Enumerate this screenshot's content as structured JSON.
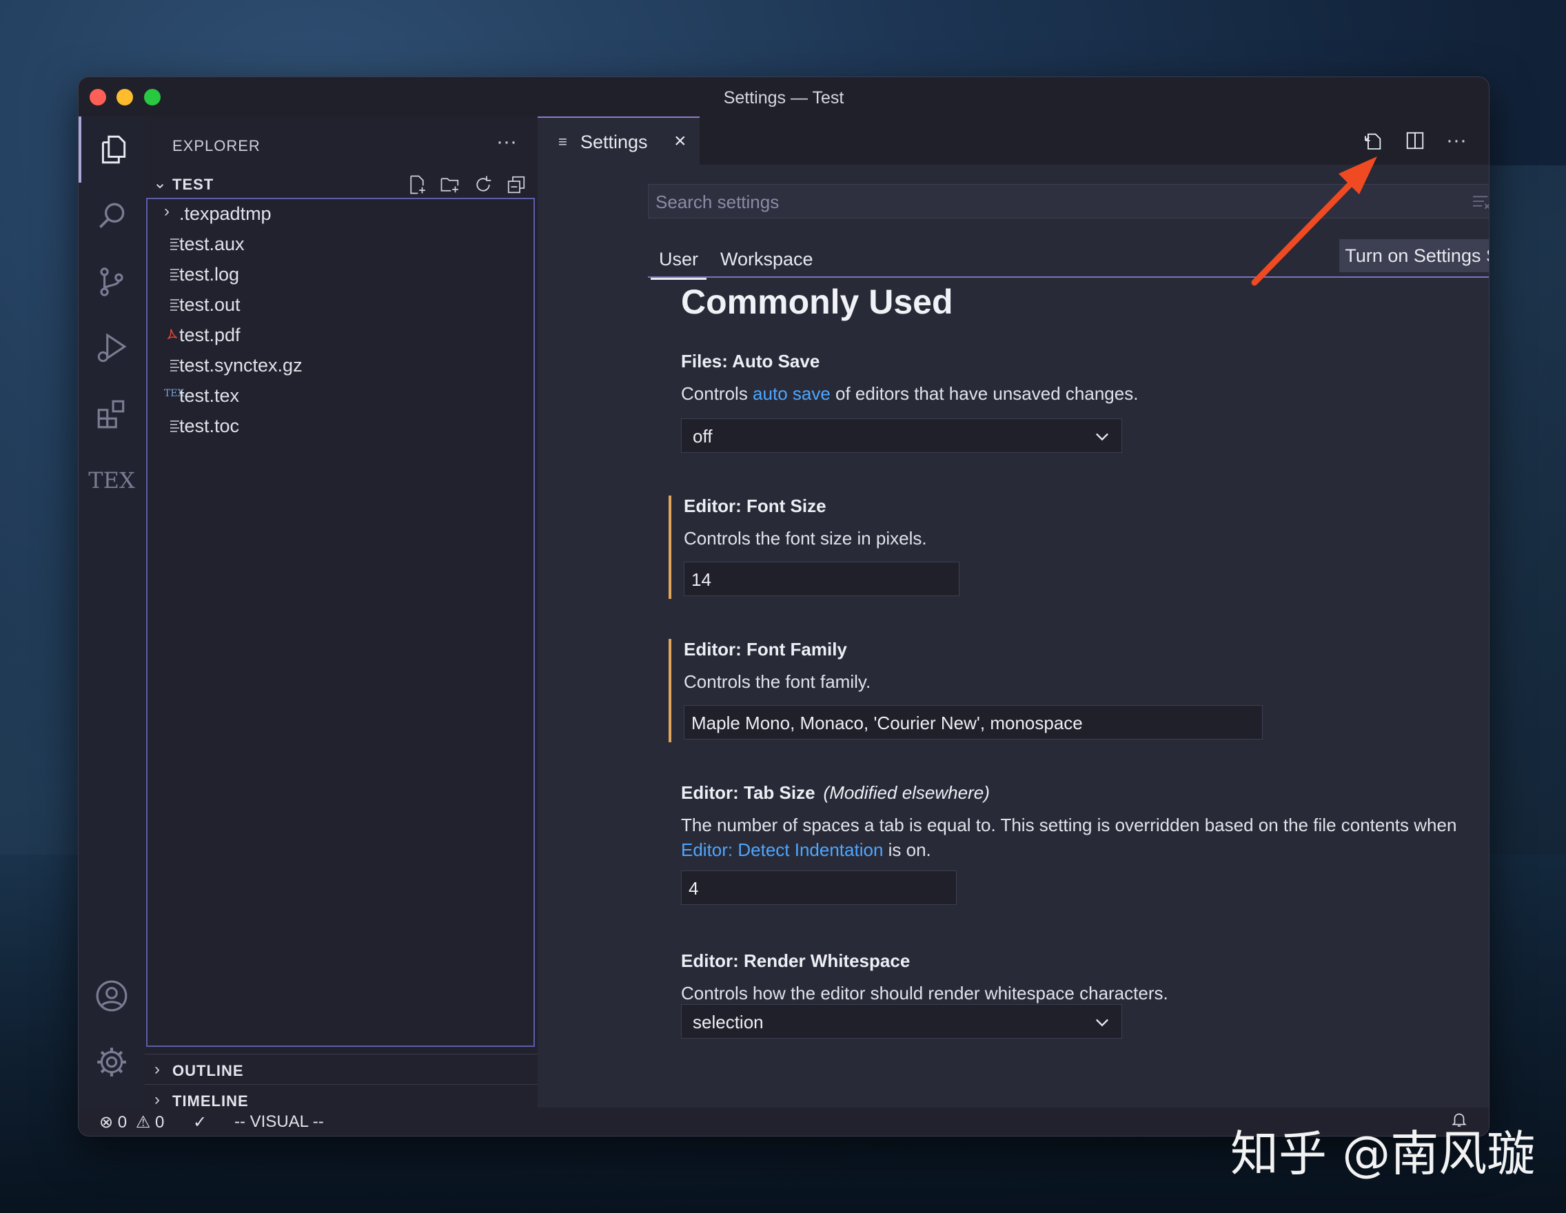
{
  "window": {
    "title": "Settings — Test"
  },
  "sidebar": {
    "title": "EXPLORER",
    "folder": "TEST",
    "items": [
      {
        "label": ".texpadtmp",
        "icon": "chevron-right-icon"
      },
      {
        "label": "test.aux",
        "icon": "file-lines-icon"
      },
      {
        "label": "test.log",
        "icon": "file-lines-icon"
      },
      {
        "label": "test.out",
        "icon": "file-lines-icon"
      },
      {
        "label": "test.pdf",
        "icon": "pdf-icon"
      },
      {
        "label": "test.synctex.gz",
        "icon": "file-lines-icon"
      },
      {
        "label": "test.tex",
        "icon": "tex-icon"
      },
      {
        "label": "test.toc",
        "icon": "file-lines-icon"
      }
    ],
    "tex_icon_text": "TEX",
    "outline": "OUTLINE",
    "timeline": "TIMELINE"
  },
  "activity": {
    "tex_label": "TEX"
  },
  "editor": {
    "tab_label": "Settings",
    "search_placeholder": "Search settings",
    "scope_user": "User",
    "scope_workspace": "Workspace",
    "sync_button": "Turn on Settings Sync",
    "heading": "Commonly Used",
    "settings": {
      "autosave": {
        "title": "Files: Auto Save",
        "desc_pre": "Controls ",
        "desc_link": "auto save",
        "desc_post": " of editors that have unsaved changes.",
        "value": "off"
      },
      "fontsize": {
        "title": "Editor: Font Size",
        "desc": "Controls the font size in pixels.",
        "value": "14"
      },
      "fontfamily": {
        "title": "Editor: Font Family",
        "desc": "Controls the font family.",
        "value": "Maple Mono, Monaco, 'Courier New', monospace"
      },
      "tabsize": {
        "title": "Editor: Tab Size",
        "note": "(Modified elsewhere)",
        "desc_pre": "The number of spaces a tab is equal to. This setting is overridden based on the file contents when ",
        "desc_link": "Editor: Detect Indentation",
        "desc_post": " is on.",
        "value": "4"
      },
      "whitespace": {
        "title": "Editor: Render Whitespace",
        "desc": "Controls how the editor should render whitespace characters.",
        "value": "selection"
      }
    }
  },
  "status": {
    "errors": "0",
    "warnings": "0",
    "mode": "-- VISUAL --"
  },
  "watermark": "知乎 @南风璇",
  "colors": {
    "accent": "#8b7fd0",
    "link": "#4fa6ff",
    "modified": "#e1a55b",
    "arrow": "#f04a23"
  }
}
